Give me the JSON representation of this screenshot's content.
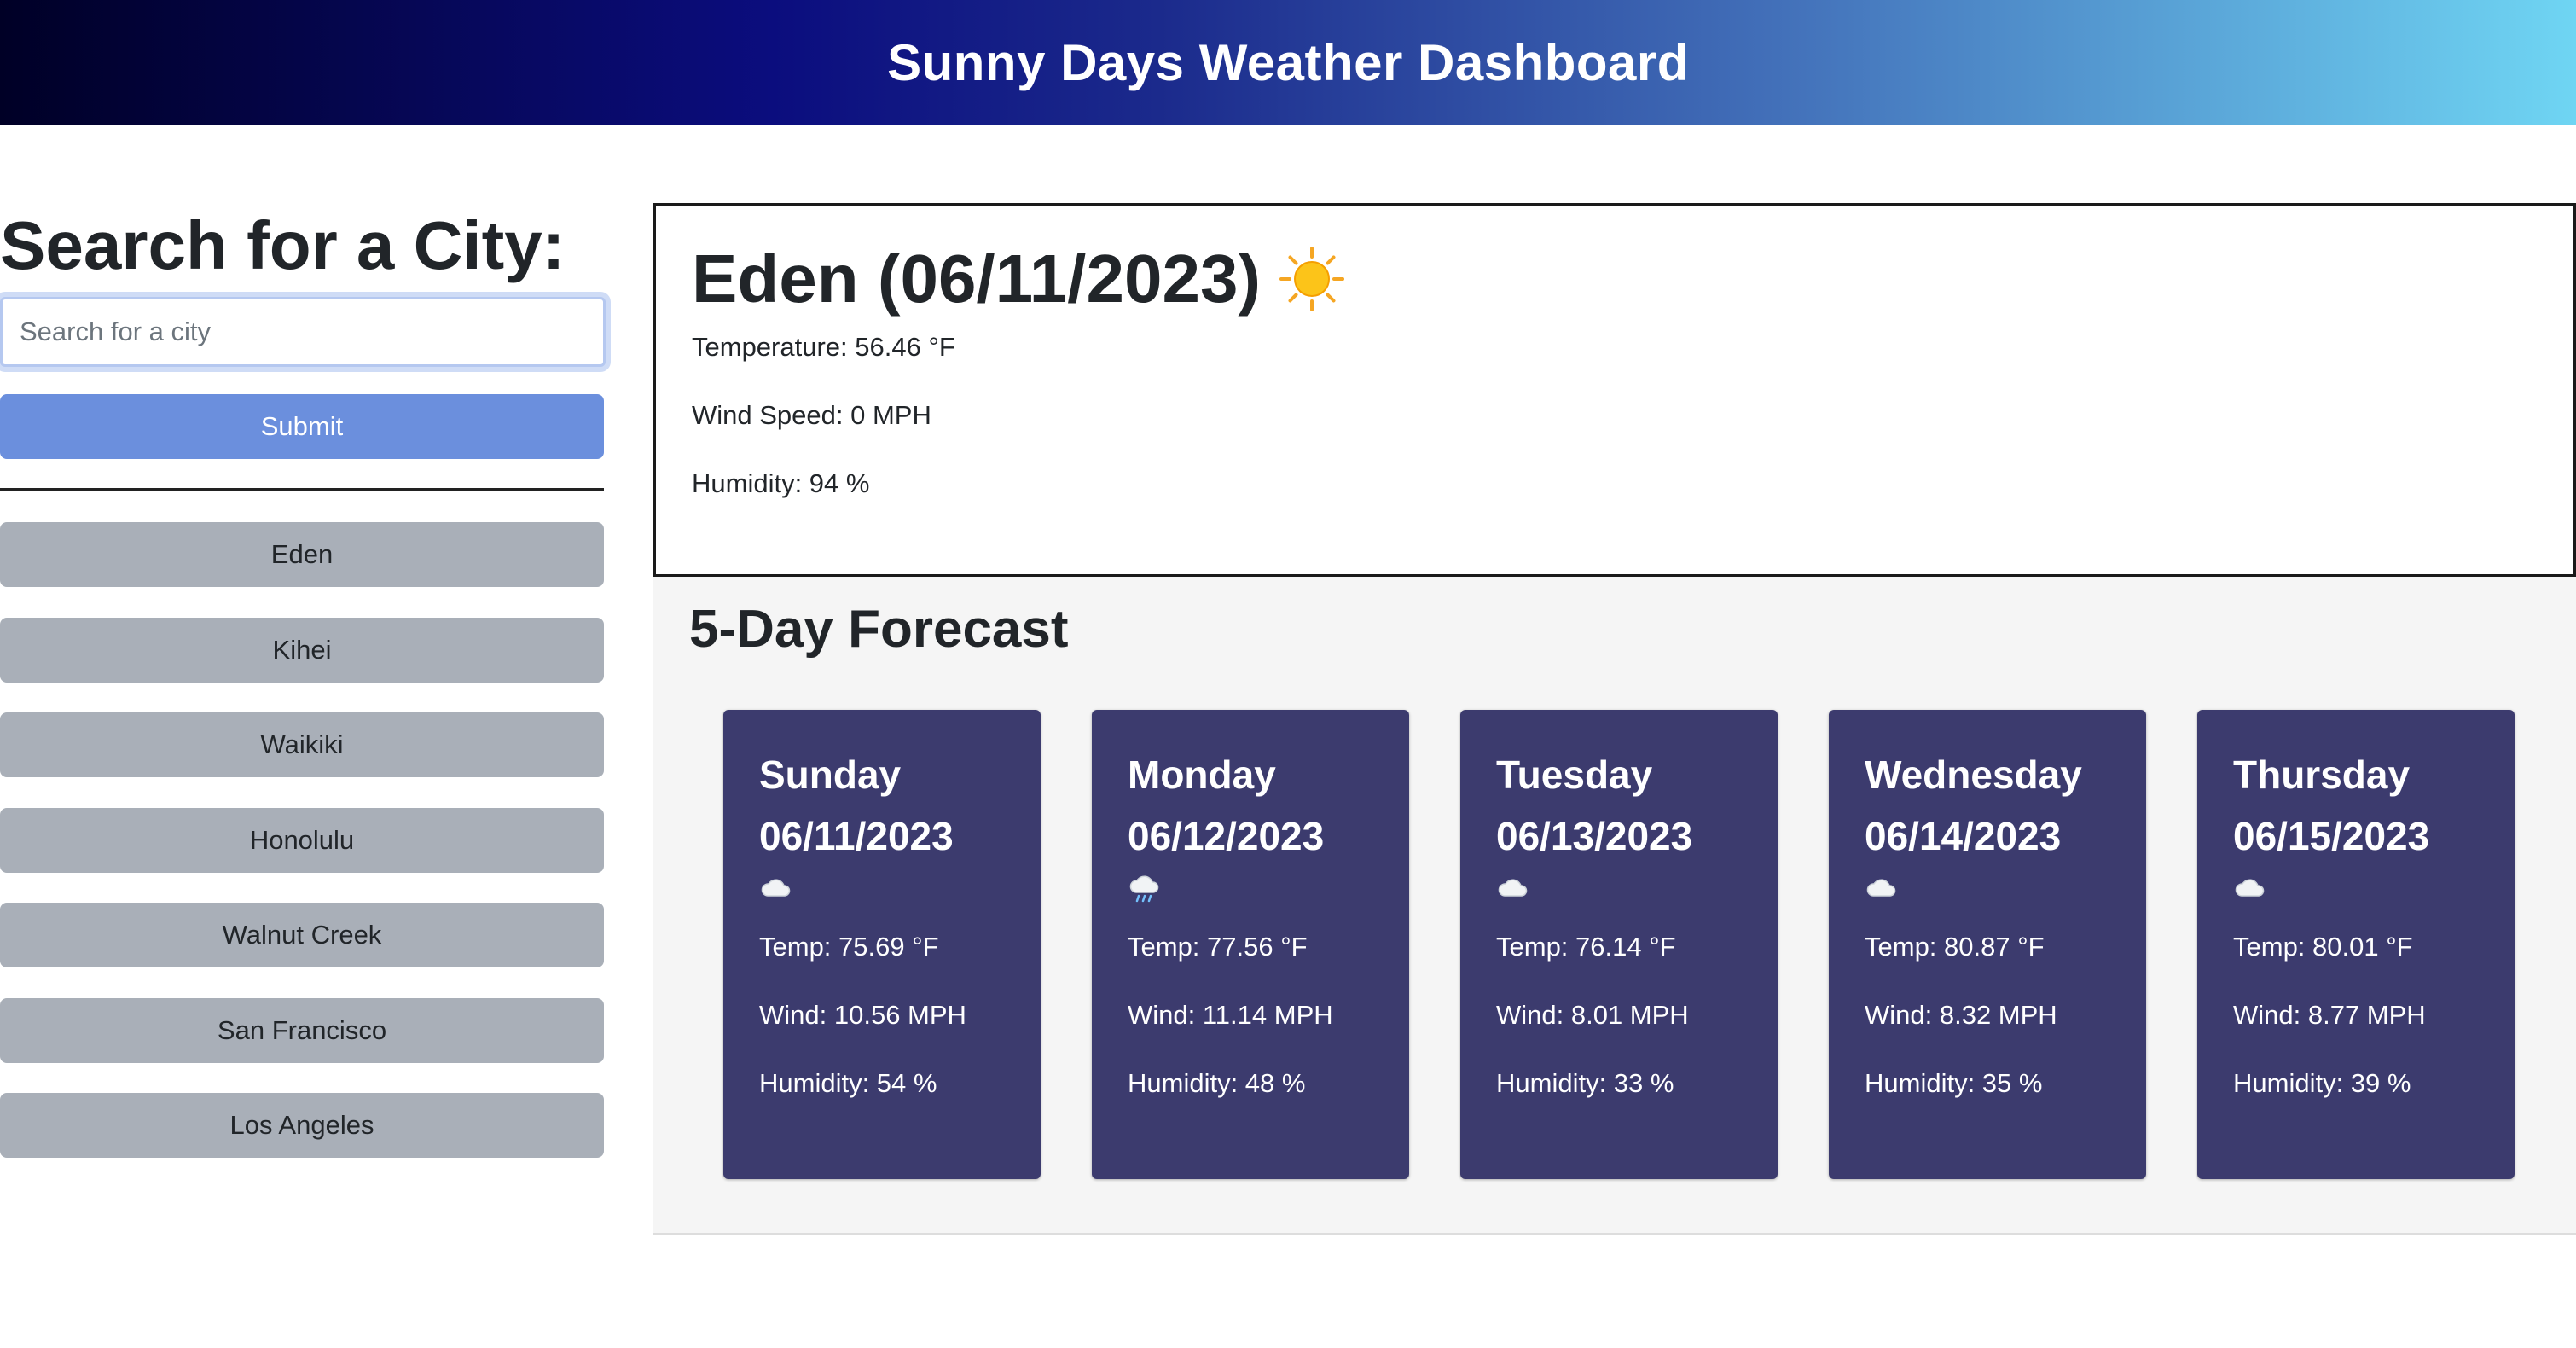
{
  "header": {
    "title": "Sunny Days Weather Dashboard"
  },
  "sidebar": {
    "heading": "Search for a City:",
    "search_placeholder": "Search for a city",
    "search_value": "",
    "submit_label": "Submit",
    "history": [
      "Eden",
      "Kihei",
      "Waikiki",
      "Honolulu",
      "Walnut Creek",
      "San Francisco",
      "Los Angeles"
    ]
  },
  "current": {
    "title": "Eden (06/11/2023)",
    "icon": "sun-icon",
    "temperature": "Temperature: 56.46 °F",
    "wind": "Wind Speed: 0 MPH",
    "humidity": "Humidity: 94 %"
  },
  "forecast": {
    "heading": "5-Day Forecast",
    "days": [
      {
        "day": "Sunday",
        "date": "06/11/2023",
        "icon": "cloud-icon",
        "temp": "Temp: 75.69 °F",
        "wind": "Wind: 10.56 MPH",
        "humidity": "Humidity: 54 %"
      },
      {
        "day": "Monday",
        "date": "06/12/2023",
        "icon": "rain-cloud-icon",
        "temp": "Temp: 77.56 °F",
        "wind": "Wind: 11.14 MPH",
        "humidity": "Humidity: 48 %"
      },
      {
        "day": "Tuesday",
        "date": "06/13/2023",
        "icon": "cloud-icon",
        "temp": "Temp: 76.14 °F",
        "wind": "Wind: 8.01 MPH",
        "humidity": "Humidity: 33 %"
      },
      {
        "day": "Wednesday",
        "date": "06/14/2023",
        "icon": "cloud-icon",
        "temp": "Temp: 80.87 °F",
        "wind": "Wind: 8.32 MPH",
        "humidity": "Humidity: 35 %"
      },
      {
        "day": "Thursday",
        "date": "06/15/2023",
        "icon": "cloud-icon",
        "temp": "Temp: 80.01 °F",
        "wind": "Wind: 8.77 MPH",
        "humidity": "Humidity: 39 %"
      }
    ]
  },
  "colors": {
    "card_bg": "#3c3b6e",
    "submit_bg": "#6b8fdd",
    "history_bg": "#a9afb8",
    "forecast_bg": "#f5f5f5"
  }
}
